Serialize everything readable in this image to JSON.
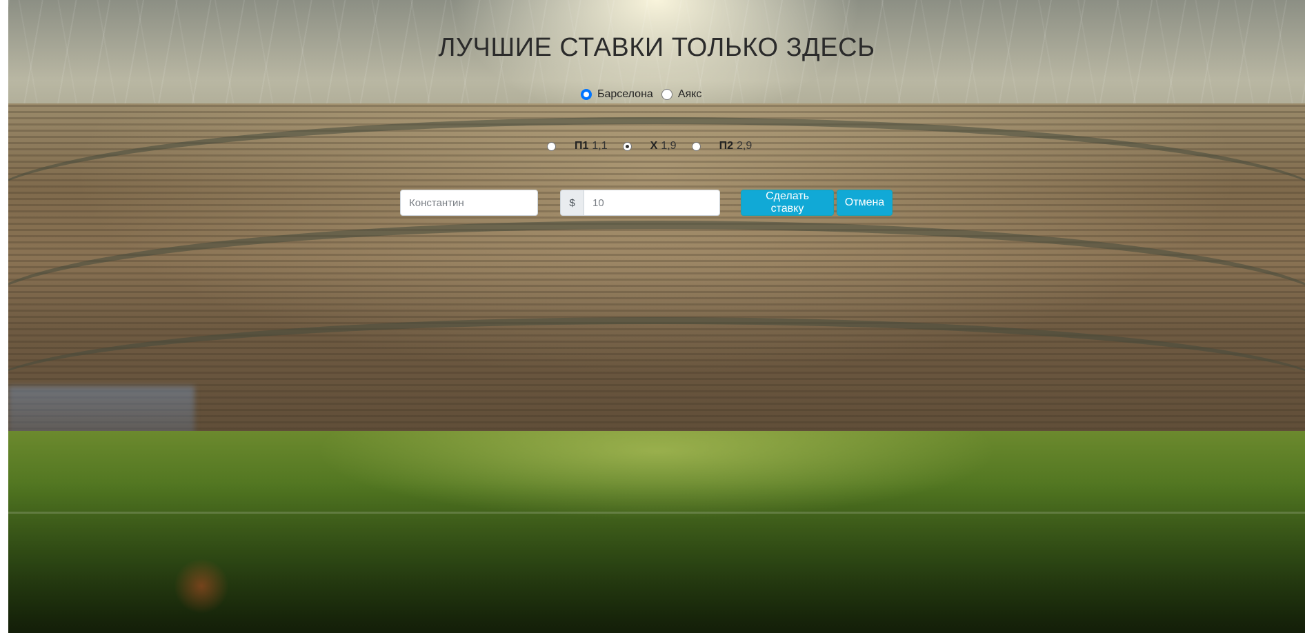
{
  "page": {
    "title": "ЛУЧШИЕ СТАВКИ ТОЛЬКО ЗДЕСЬ"
  },
  "teams": {
    "selected": "Барселона",
    "options": [
      {
        "label": "Барселона",
        "checked": true
      },
      {
        "label": "Аякс",
        "checked": false
      }
    ]
  },
  "odds": {
    "selected": "X",
    "options": [
      {
        "code": "П1",
        "value": "1,1",
        "checked": false
      },
      {
        "code": "X",
        "value": "1,9",
        "checked": true
      },
      {
        "code": "П2",
        "value": "2,9",
        "checked": false
      }
    ]
  },
  "form": {
    "name_placeholder": "Константин",
    "currency_symbol": "$",
    "amount_placeholder": "10",
    "bet_button": "Сделать ставку",
    "cancel_button": "Отмена"
  },
  "colors": {
    "button_bg": "#11a9d6",
    "radio_checked": "#0075ff",
    "title": "#2b2b2b"
  }
}
